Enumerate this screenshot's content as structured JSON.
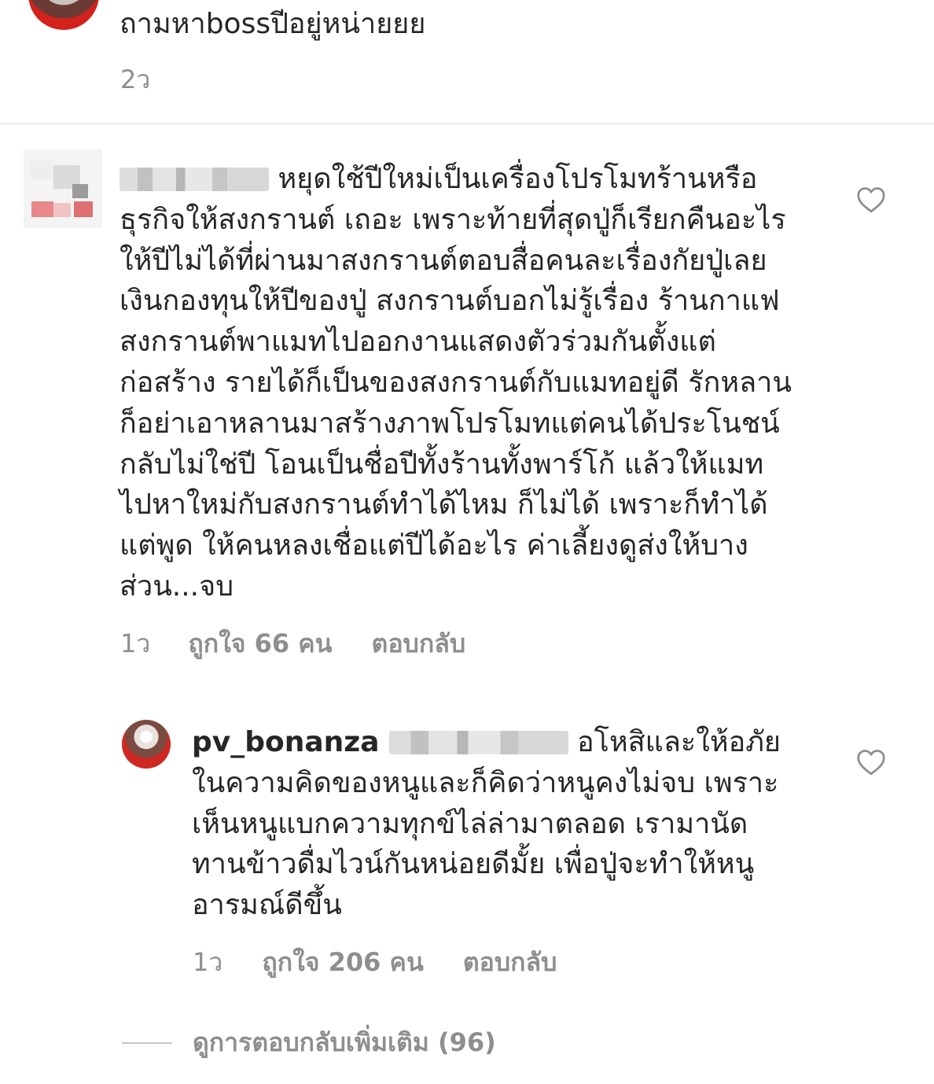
{
  "previous_comment": {
    "text": "ถามหาbossปีอยู่หน่ายยย",
    "time": "2ว"
  },
  "comment": {
    "text": "หยุดใช้ปีใหม่เป็นเครื่องโปรโมทร้านหรือธุรกิจให้สงกรานต์ เถอะ เพราะท้ายที่สุดปู่ก็เรียกคืนอะไรให้ปีไม่ได้ที่ผ่านมาสงกรานต์ตอบสื่อคนละเรื่องกัยปู่เลย เงินกองทุนให้ปีของปู่ สงกรานต์บอกไม่รู้เรื่อง ร้านกาแฟสงกรานต์พาแมทไปออกงานแสดงตัวร่วมกันตั้งแต่ก่อสร้าง รายได้ก็เป็นของสงกรานต์กับแมทอยู่ดี  รักหลานก็อย่าเอาหลานมาสร้างภาพโปรโมทแต่คนได้ประโนชน์กลับไม่ใช่ปี โอนเป็นชื่อปีทั้งร้านทั้งพาร์โก้ แล้วให้แมทไปหาใหม่กับสงกรานต์ทำได้ไหม ก็ไม่ได้ เพราะก็ทำได้แต่พูด ให้คนหลงเชื่อแต่ปีได้อะไร ค่าเลี้ยงดูส่งให้บางส่วน...จบ",
    "time": "1ว",
    "likes": "ถูกใจ 66 คน",
    "reply_label": "ตอบกลับ"
  },
  "reply": {
    "username": "pv_bonanza",
    "text": "อโหสิและให้อภัยในความคิดของหนูและก็คิดว่าหนูคงไม่จบ เพราะเห็นหนูแบกความทุกข์ไล่ล่ามาตลอด เรามานัดทานข้าวดื่มไวน์กันหน่อยดีมั้ย เพื่อปู่จะทำให้หนูอารมณ์ดีขึ้น",
    "time": "1ว",
    "likes": "ถูกใจ 206 คน",
    "reply_label": "ตอบกลับ"
  },
  "view_more_replies": "ดูการตอบกลับเพิ่มเติม (96)",
  "colors": {
    "text": "#262626",
    "muted": "#8e8e8e",
    "divider": "#dbdbdb",
    "heart_stroke": "#8e8e8e"
  },
  "icons": {
    "like": "heart-outline-icon"
  }
}
